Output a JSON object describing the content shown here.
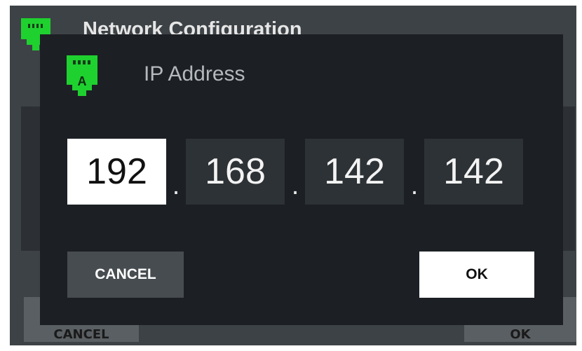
{
  "background": {
    "title": "Network Configuration",
    "cancel_label": "CANCEL",
    "ok_label": "OK",
    "icon": "ethernet-port-icon"
  },
  "dialog": {
    "title": "IP Address",
    "icon": "ethernet-port-icon",
    "icon_letter": "A",
    "octets": [
      "192",
      "168",
      "142",
      "142"
    ],
    "separator": ".",
    "active_octet": 1,
    "cancel_label": "CANCEL",
    "ok_label": "OK"
  },
  "colors": {
    "accent": "#1fd12f",
    "dialog_bg": "#1c2024",
    "field_bg": "#2d3236",
    "field_active_bg": "#ffffff"
  }
}
